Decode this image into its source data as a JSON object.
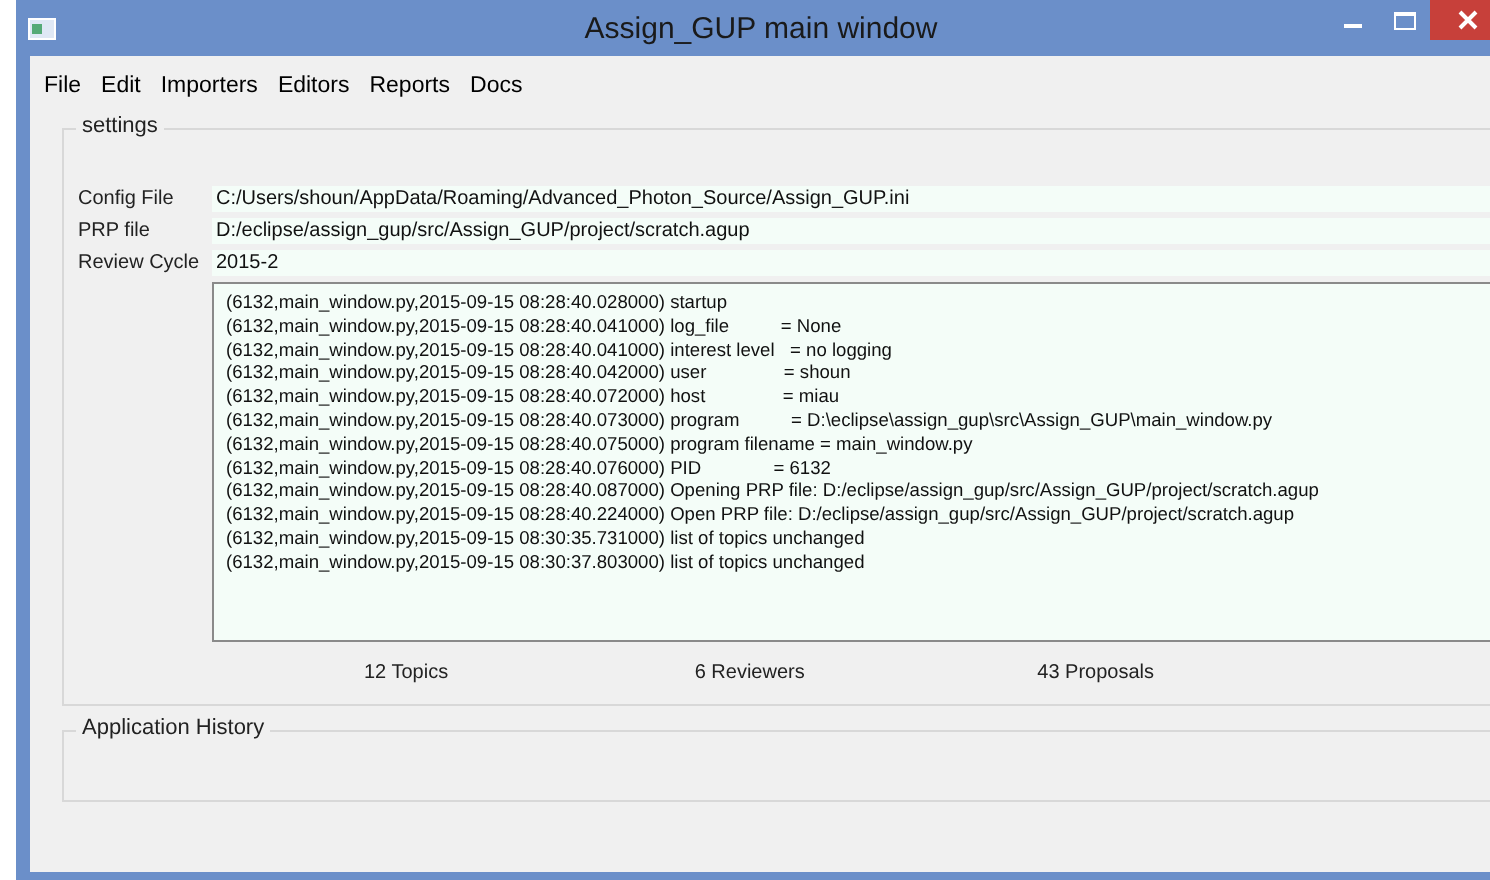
{
  "window": {
    "title": "Assign_GUP main window"
  },
  "menu": [
    "File",
    "Edit",
    "Importers",
    "Editors",
    "Reports",
    "Docs"
  ],
  "settings": {
    "title": "settings",
    "fields": [
      {
        "label": "Config File",
        "value": "C:/Users/shoun/AppData/Roaming/Advanced_Photon_Source/Assign_GUP.ini"
      },
      {
        "label": "PRP file",
        "value": "D:/eclipse/assign_gup/src/Assign_GUP/project/scratch.agup"
      },
      {
        "label": "Review Cycle",
        "value": "2015-2"
      }
    ],
    "log": [
      "(6132,main_window.py,2015-09-15 08:28:40.028000) startup",
      "(6132,main_window.py,2015-09-15 08:28:40.041000) log_file          = None",
      "(6132,main_window.py,2015-09-15 08:28:40.041000) interest level   = no logging",
      "(6132,main_window.py,2015-09-15 08:28:40.042000) user               = shoun",
      "(6132,main_window.py,2015-09-15 08:28:40.072000) host               = miau",
      "(6132,main_window.py,2015-09-15 08:28:40.073000) program          = D:\\eclipse\\assign_gup\\src\\Assign_GUP\\main_window.py",
      "(6132,main_window.py,2015-09-15 08:28:40.075000) program filename = main_window.py",
      "(6132,main_window.py,2015-09-15 08:28:40.076000) PID              = 6132",
      "(6132,main_window.py,2015-09-15 08:28:40.087000) Opening PRP file: D:/eclipse/assign_gup/src/Assign_GUP/project/scratch.agup",
      "(6132,main_window.py,2015-09-15 08:28:40.224000) Open PRP file: D:/eclipse/assign_gup/src/Assign_GUP/project/scratch.agup",
      "(6132,main_window.py,2015-09-15 08:30:35.731000) list of topics unchanged",
      "(6132,main_window.py,2015-09-15 08:30:37.803000) list of topics unchanged"
    ],
    "counts": [
      "12  Topics",
      "6  Reviewers",
      "43  Proposals"
    ]
  },
  "history": {
    "title": "Application History"
  }
}
